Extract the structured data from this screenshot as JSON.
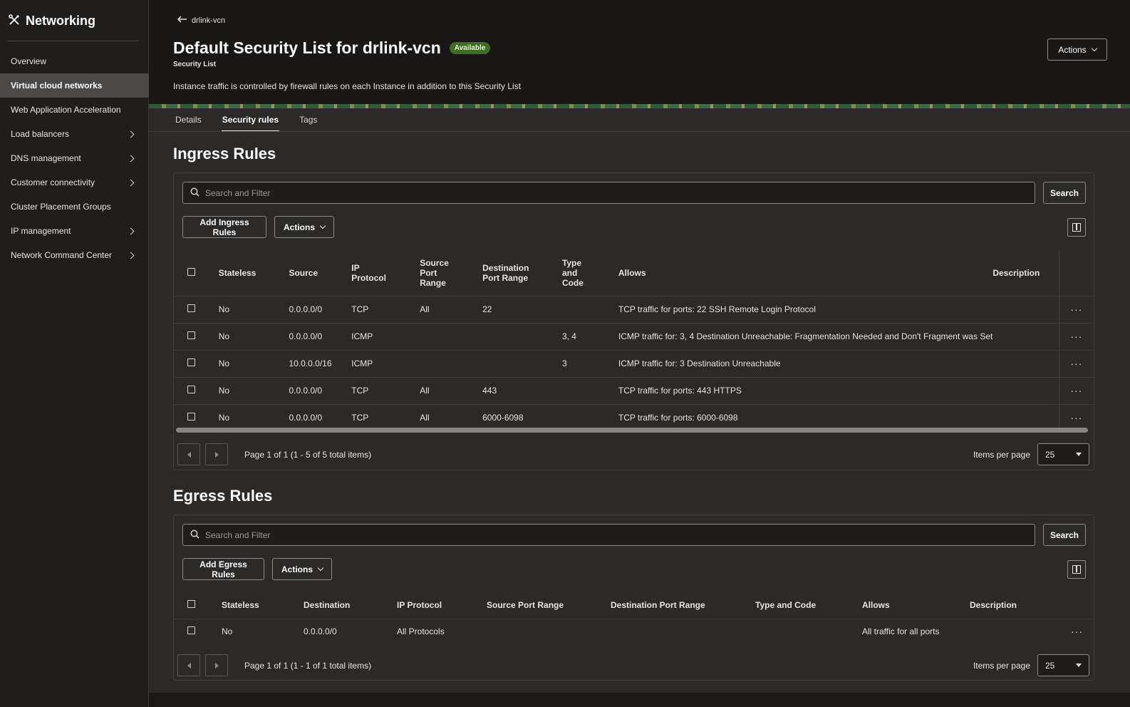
{
  "sidebar": {
    "brand": "Networking",
    "items": [
      {
        "label": "Overview",
        "active": false,
        "has_children": false
      },
      {
        "label": "Virtual cloud networks",
        "active": true,
        "has_children": false
      },
      {
        "label": "Web Application Acceleration",
        "active": false,
        "has_children": false
      },
      {
        "label": "Load balancers",
        "active": false,
        "has_children": true
      },
      {
        "label": "DNS management",
        "active": false,
        "has_children": true
      },
      {
        "label": "Customer connectivity",
        "active": false,
        "has_children": true
      },
      {
        "label": "Cluster Placement Groups",
        "active": false,
        "has_children": false
      },
      {
        "label": "IP management",
        "active": false,
        "has_children": true
      },
      {
        "label": "Network Command Center",
        "active": false,
        "has_children": true
      }
    ]
  },
  "header": {
    "back_label": "drlink-vcn",
    "title": "Default Security List for drlink-vcn",
    "status": "Available",
    "status_color": "#3f6d24",
    "subtitle": "Security List",
    "notice": "Instance traffic is controlled by firewall rules on each Instance in addition to this Security List",
    "actions_label": "Actions"
  },
  "tabs": [
    {
      "label": "Details",
      "active": false
    },
    {
      "label": "Security rules",
      "active": true
    },
    {
      "label": "Tags",
      "active": false
    }
  ],
  "ingress": {
    "title": "Ingress Rules",
    "search_placeholder": "Search and Filter",
    "search_button": "Search",
    "add_button": "Add Ingress Rules",
    "actions_label": "Actions",
    "columns": {
      "stateless": "Stateless",
      "source": "Source",
      "ip_protocol": "IP Protocol",
      "source_port_range": "Source Port Range",
      "destination_port_range": "Destination Port Range",
      "type_and_code": "Type and Code",
      "allows": "Allows",
      "description": "Description"
    },
    "rows": [
      {
        "stateless": "No",
        "source": "0.0.0.0/0",
        "ip_protocol": "TCP",
        "source_port_range": "All",
        "destination_port_range": "22",
        "type_and_code": "",
        "allows": "TCP traffic for ports: 22 SSH Remote Login Protocol",
        "description": ""
      },
      {
        "stateless": "No",
        "source": "0.0.0.0/0",
        "ip_protocol": "ICMP",
        "source_port_range": "",
        "destination_port_range": "",
        "type_and_code": "3, 4",
        "allows": "ICMP traffic for: 3, 4 Destination Unreachable: Fragmentation Needed and Don't Fragment was Set",
        "description": ""
      },
      {
        "stateless": "No",
        "source": "10.0.0.0/16",
        "ip_protocol": "ICMP",
        "source_port_range": "",
        "destination_port_range": "",
        "type_and_code": "3",
        "allows": "ICMP traffic for: 3 Destination Unreachable",
        "description": ""
      },
      {
        "stateless": "No",
        "source": "0.0.0.0/0",
        "ip_protocol": "TCP",
        "source_port_range": "All",
        "destination_port_range": "443",
        "type_and_code": "",
        "allows": "TCP traffic for ports: 443 HTTPS",
        "description": ""
      },
      {
        "stateless": "No",
        "source": "0.0.0.0/0",
        "ip_protocol": "TCP",
        "source_port_range": "All",
        "destination_port_range": "6000-6098",
        "type_and_code": "",
        "allows": "TCP traffic for ports: 6000-6098",
        "description": ""
      }
    ],
    "pagination": {
      "text": "Page 1 of 1 (1 - 5 of 5 total items)",
      "items_per_page_label": "Items per page",
      "items_per_page": "25"
    }
  },
  "egress": {
    "title": "Egress Rules",
    "search_placeholder": "Search and Filter",
    "search_button": "Search",
    "add_button": "Add Egress Rules",
    "actions_label": "Actions",
    "columns": {
      "stateless": "Stateless",
      "destination": "Destination",
      "ip_protocol": "IP Protocol",
      "source_port_range": "Source Port Range",
      "destination_port_range": "Destination Port Range",
      "type_and_code": "Type and Code",
      "allows": "Allows",
      "description": "Description"
    },
    "rows": [
      {
        "stateless": "No",
        "destination": "0.0.0.0/0",
        "ip_protocol": "All Protocols",
        "source_port_range": "",
        "destination_port_range": "",
        "type_and_code": "",
        "allows": "All traffic for all ports",
        "description": ""
      }
    ],
    "pagination": {
      "text": "Page 1 of 1 (1 - 1 of 1 total items)",
      "items_per_page_label": "Items per page",
      "items_per_page": "25"
    }
  },
  "icons": {
    "brand": "networking-icon",
    "back": "arrow-left-icon",
    "search": "search-icon",
    "columns": "columns-icon",
    "row_menu": "kebab-menu-icon"
  }
}
